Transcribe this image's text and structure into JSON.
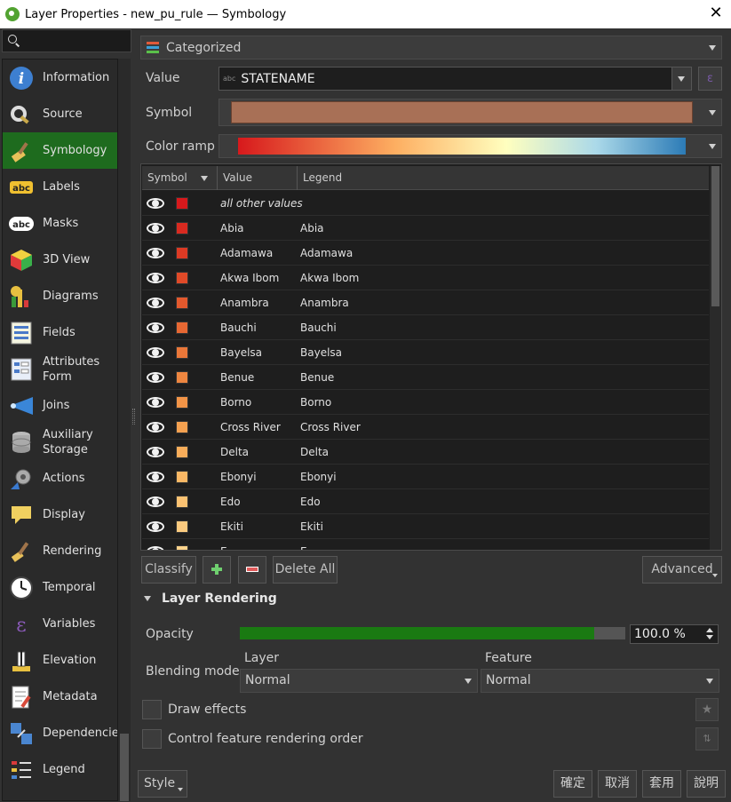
{
  "window": {
    "title": "Layer Properties - new_pu_rule — Symbology"
  },
  "search": {
    "placeholder": ""
  },
  "sidebar": {
    "items": [
      {
        "label": "Information",
        "icon": "information-icon"
      },
      {
        "label": "Source",
        "icon": "source-icon"
      },
      {
        "label": "Symbology",
        "icon": "symbology-icon",
        "active": true
      },
      {
        "label": "Labels",
        "icon": "labels-icon"
      },
      {
        "label": "Masks",
        "icon": "masks-icon"
      },
      {
        "label": "3D View",
        "icon": "3d-view-icon"
      },
      {
        "label": "Diagrams",
        "icon": "diagrams-icon"
      },
      {
        "label": "Fields",
        "icon": "fields-icon"
      },
      {
        "label": "Attributes Form",
        "icon": "attributes-form-icon"
      },
      {
        "label": "Joins",
        "icon": "joins-icon"
      },
      {
        "label": "Auxiliary Storage",
        "icon": "auxiliary-storage-icon"
      },
      {
        "label": "Actions",
        "icon": "actions-icon"
      },
      {
        "label": "Display",
        "icon": "display-icon"
      },
      {
        "label": "Rendering",
        "icon": "rendering-icon"
      },
      {
        "label": "Temporal",
        "icon": "temporal-icon"
      },
      {
        "label": "Variables",
        "icon": "variables-icon"
      },
      {
        "label": "Elevation",
        "icon": "elevation-icon"
      },
      {
        "label": "Metadata",
        "icon": "metadata-icon"
      },
      {
        "label": "Dependencies",
        "icon": "dependencies-icon"
      },
      {
        "label": "Legend",
        "icon": "legend-icon"
      }
    ]
  },
  "symbology": {
    "renderer": "Categorized",
    "value_label": "Value",
    "value_field": "STATENAME",
    "value_type_badge": "abc",
    "symbol_label": "Symbol",
    "symbol_color": "#a87056",
    "color_ramp_label": "Color ramp",
    "expression_button": "ε"
  },
  "table": {
    "headers": {
      "symbol": "Symbol",
      "value": "Value",
      "legend": "Legend"
    },
    "rows": [
      {
        "value": "all other values",
        "legend": "",
        "color": "#d7191c",
        "other": true
      },
      {
        "value": "Abia",
        "legend": "Abia",
        "color": "#d92a20"
      },
      {
        "value": "Adamawa",
        "legend": "Adamawa",
        "color": "#dc3a24"
      },
      {
        "value": "Akwa Ibom",
        "legend": "Akwa Ibom",
        "color": "#e04a28"
      },
      {
        "value": "Anambra",
        "legend": "Anambra",
        "color": "#e3592d"
      },
      {
        "value": "Bauchi",
        "legend": "Bauchi",
        "color": "#e76833"
      },
      {
        "value": "Bayelsa",
        "legend": "Bayelsa",
        "color": "#ea7739"
      },
      {
        "value": "Benue",
        "legend": "Benue",
        "color": "#ee8640"
      },
      {
        "value": "Borno",
        "legend": "Borno",
        "color": "#f29447"
      },
      {
        "value": "Cross River",
        "legend": "Cross River",
        "color": "#f5a150"
      },
      {
        "value": "Delta",
        "legend": "Delta",
        "color": "#f8ad5a"
      },
      {
        "value": "Ebonyi",
        "legend": "Ebonyi",
        "color": "#fab865"
      },
      {
        "value": "Edo",
        "legend": "Edo",
        "color": "#fbc272"
      },
      {
        "value": "Ekiti",
        "legend": "Ekiti",
        "color": "#fccb7f"
      },
      {
        "value": "E...",
        "legend": "E...",
        "color": "#fdd38c"
      }
    ]
  },
  "buttons": {
    "classify": "Classify",
    "delete_all": "Delete All",
    "advanced": "Advanced"
  },
  "layer_rendering": {
    "title": "Layer Rendering",
    "opacity_label": "Opacity",
    "opacity_fraction": 1.0,
    "opacity_value": "100.0 %",
    "blending_label": "Blending mode",
    "layer_label": "Layer",
    "feature_label": "Feature",
    "layer_mode": "Normal",
    "feature_mode": "Normal",
    "draw_effects": "Draw effects",
    "control_order": "Control feature rendering order"
  },
  "footer": {
    "style": "Style",
    "ok": "確定",
    "cancel": "取消",
    "apply": "套用",
    "help": "說明"
  }
}
